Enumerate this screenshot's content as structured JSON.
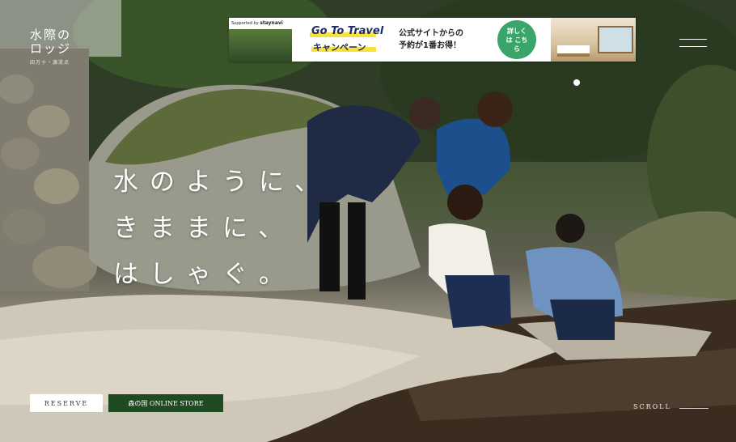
{
  "brand": {
    "name": "水際のロッジ",
    "tagline": "四万十・源流点"
  },
  "banner": {
    "supported_by": "Supported by",
    "sponsor": "staynavi",
    "goto": "Go To Travel",
    "campaign": "キャンペーン",
    "offer_line1": "公式サイトからの",
    "offer_line2": "予約が1番お得！",
    "badge": "詳しくは こちら"
  },
  "hero": {
    "line1": "水のように、",
    "line2": "きままに、",
    "line3": "はしゃぐ。"
  },
  "buttons": {
    "reserve": "RESERVE",
    "store": "森の国 ONLINE STORE"
  },
  "scroll": {
    "label": "SCROLL"
  },
  "colors": {
    "store_green": "#1f4a22",
    "badge_green": "#3aa56b",
    "highlight_yellow": "#f5e23a"
  }
}
